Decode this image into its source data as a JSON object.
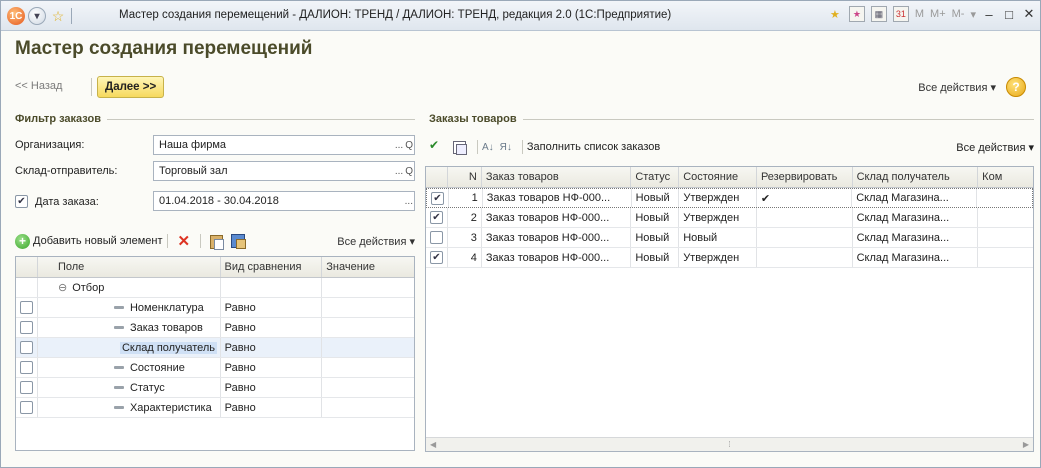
{
  "window": {
    "title": "Мастер создания перемещений - ДАЛИОН: ТРЕНД / ДАЛИОН: ТРЕНД, редакция 2.0  (1С:Предприятие)",
    "right_tools": [
      "M",
      "M+",
      "M-"
    ]
  },
  "form": {
    "title": "Мастер создания перемещений",
    "back_label": "<< Назад",
    "next_label": "Далее >>",
    "all_actions_label": "Все действия ▾",
    "help_label": "?"
  },
  "filter": {
    "heading": "Фильтр заказов",
    "org_label": "Организация:",
    "org_value": "Наша фирма",
    "warehouse_label": "Склад-отправитель:",
    "warehouse_value": "Торговый зал",
    "date_label": "Дата заказа:",
    "date_value": "01.04.2018 - 30.04.2018",
    "date_checked": true,
    "ellipsis": "...",
    "search_glyph": "Q"
  },
  "filter_toolbar": {
    "add_label": "Добавить новый элемент",
    "all_actions_label": "Все действия ▾"
  },
  "filter_table": {
    "columns": [
      "Поле",
      "Вид сравнения",
      "Значение"
    ],
    "group_label": "Отбор",
    "group_glyph": "⊖",
    "rows": [
      {
        "field": "Номенклатура",
        "compare": "Равно",
        "value": ""
      },
      {
        "field": "Заказ товаров",
        "compare": "Равно",
        "value": ""
      },
      {
        "field": "Склад получатель",
        "compare": "Равно",
        "value": ""
      },
      {
        "field": "Состояние",
        "compare": "Равно",
        "value": ""
      },
      {
        "field": "Статус",
        "compare": "Равно",
        "value": ""
      },
      {
        "field": "Характеристика",
        "compare": "Равно",
        "value": ""
      }
    ]
  },
  "orders": {
    "heading": "Заказы товаров",
    "fill_label": "Заполнить список заказов",
    "all_actions_label": "Все действия ▾",
    "columns": [
      "N",
      "Заказ товаров",
      "Статус",
      "Состояние",
      "Резервировать",
      "Склад получатель",
      "Ком"
    ],
    "rows": [
      {
        "checked": true,
        "n": "1",
        "order": "Заказ товаров НФ-000...",
        "status": "Новый",
        "state": "Утвержден",
        "reserve": "✔",
        "warehouse": "Склад Магазина..."
      },
      {
        "checked": true,
        "n": "2",
        "order": "Заказ товаров НФ-000...",
        "status": "Новый",
        "state": "Утвержден",
        "reserve": "",
        "warehouse": "Склад Магазина..."
      },
      {
        "checked": false,
        "n": "3",
        "order": "Заказ товаров НФ-000...",
        "status": "Новый",
        "state": "Новый",
        "reserve": "",
        "warehouse": "Склад Магазина..."
      },
      {
        "checked": true,
        "n": "4",
        "order": "Заказ товаров НФ-000...",
        "status": "Новый",
        "state": "Утвержден",
        "reserve": "",
        "warehouse": "Склад Магазина..."
      }
    ]
  }
}
